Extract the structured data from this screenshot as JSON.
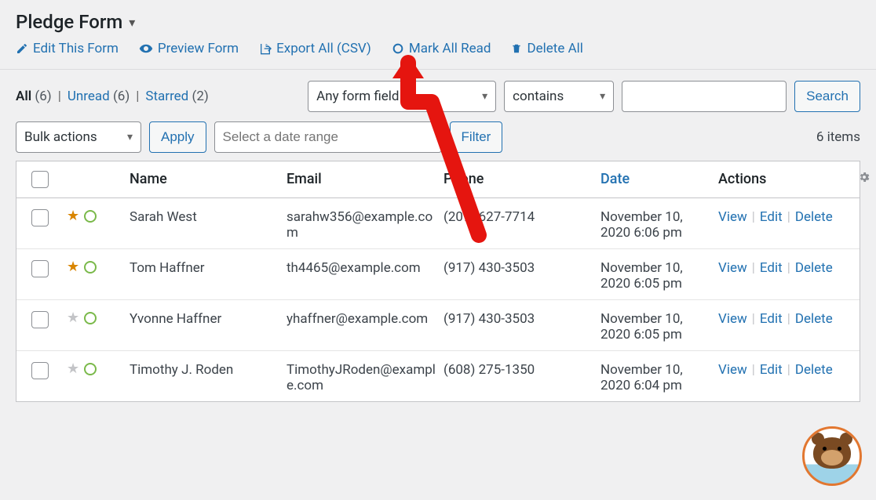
{
  "header": {
    "title": "Pledge Form",
    "actions": {
      "edit": "Edit This Form",
      "preview": "Preview Form",
      "export": "Export All (CSV)",
      "markread": "Mark All Read",
      "deleteall": "Delete All"
    }
  },
  "filters": {
    "tabs": {
      "all_label": "All",
      "all_count": "(6)",
      "unread_label": "Unread",
      "unread_count": "(6)",
      "starred_label": "Starred",
      "starred_count": "(2)"
    },
    "field_select": "Any form field",
    "operator_select": "contains",
    "search_value": "",
    "search_btn": "Search",
    "bulk_label": "Bulk actions",
    "apply_btn": "Apply",
    "date_placeholder": "Select a date range",
    "filter_btn": "Filter",
    "items_count": "6 items"
  },
  "table": {
    "headers": {
      "name": "Name",
      "email": "Email",
      "phone": "Phone",
      "date": "Date",
      "actions": "Actions"
    },
    "action_labels": {
      "view": "View",
      "edit": "Edit",
      "delete": "Delete"
    },
    "rows": [
      {
        "starred": true,
        "name": "Sarah West",
        "email": "sarahw356@example.com",
        "phone": "(209) 627-7714",
        "date": "November 10, 2020 6:06 pm"
      },
      {
        "starred": true,
        "name": "Tom Haffner",
        "email": "th4465@example.com",
        "phone": "(917) 430-3503",
        "date": "November 10, 2020 6:05 pm"
      },
      {
        "starred": false,
        "name": "Yvonne Haffner",
        "email": "yhaffner@example.com",
        "phone": "(917) 430-3503",
        "date": "November 10, 2020 6:05 pm"
      },
      {
        "starred": false,
        "name": "Timothy J. Roden",
        "email": "TimothyJRoden@example.com",
        "phone": "(608) 275-1350",
        "date": "November 10, 2020 6:04 pm"
      }
    ]
  }
}
